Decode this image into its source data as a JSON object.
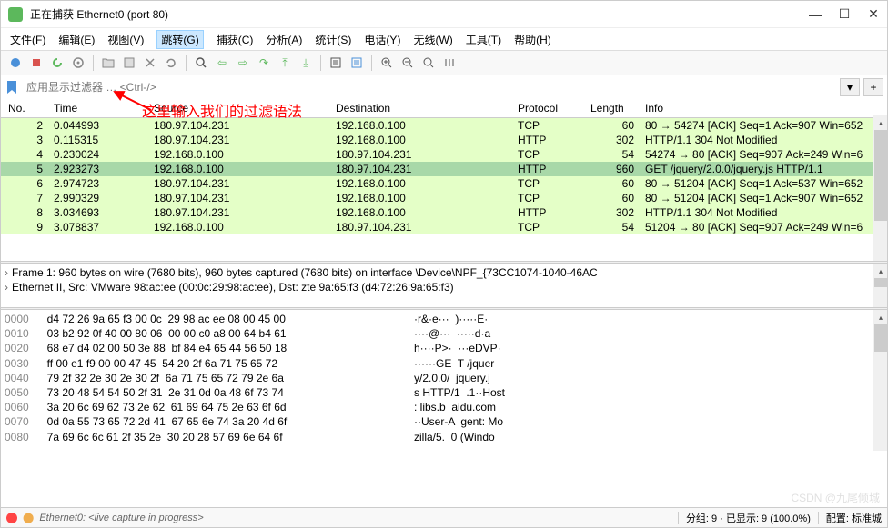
{
  "window": {
    "title": "正在捕获 Ethernet0 (port 80)",
    "min": "—",
    "max": "☐",
    "close": "✕"
  },
  "menu": [
    {
      "label": "文件",
      "key": "F"
    },
    {
      "label": "编辑",
      "key": "E"
    },
    {
      "label": "视图",
      "key": "V"
    },
    {
      "label": "跳转",
      "key": "G",
      "highlight": true
    },
    {
      "label": "捕获",
      "key": "C"
    },
    {
      "label": "分析",
      "key": "A"
    },
    {
      "label": "统计",
      "key": "S"
    },
    {
      "label": "电话",
      "key": "Y"
    },
    {
      "label": "无线",
      "key": "W"
    },
    {
      "label": "工具",
      "key": "T"
    },
    {
      "label": "帮助",
      "key": "H"
    }
  ],
  "filter": {
    "placeholder": "应用显示过滤器 … <Ctrl-/>",
    "plus": "+"
  },
  "annotation": "这里输入我们的过滤语法",
  "columns": {
    "no": "No.",
    "time": "Time",
    "source": "Source",
    "destination": "Destination",
    "protocol": "Protocol",
    "length": "Length",
    "info": "Info"
  },
  "packets": [
    {
      "no": "2",
      "time": "0.044993",
      "src": "180.97.104.231",
      "dst": "192.168.0.100",
      "proto": "TCP",
      "len": "60",
      "info": "80 → 54274 [ACK] Seq=1 Ack=907 Win=652",
      "cls": "row-green"
    },
    {
      "no": "3",
      "time": "0.115315",
      "src": "180.97.104.231",
      "dst": "192.168.0.100",
      "proto": "HTTP",
      "len": "302",
      "info": "HTTP/1.1 304 Not Modified",
      "cls": "row-green"
    },
    {
      "no": "4",
      "time": "0.230024",
      "src": "192.168.0.100",
      "dst": "180.97.104.231",
      "proto": "TCP",
      "len": "54",
      "info": "54274 → 80 [ACK] Seq=907 Ack=249 Win=6",
      "cls": "row-green"
    },
    {
      "no": "5",
      "time": "2.923273",
      "src": "192.168.0.100",
      "dst": "180.97.104.231",
      "proto": "HTTP",
      "len": "960",
      "info": "GET /jquery/2.0.0/jquery.js HTTP/1.1",
      "cls": "row-blue-sel"
    },
    {
      "no": "6",
      "time": "2.974723",
      "src": "180.97.104.231",
      "dst": "192.168.0.100",
      "proto": "TCP",
      "len": "60",
      "info": "80 → 51204 [ACK] Seq=1 Ack=537 Win=652",
      "cls": "row-green"
    },
    {
      "no": "7",
      "time": "2.990329",
      "src": "180.97.104.231",
      "dst": "192.168.0.100",
      "proto": "TCP",
      "len": "60",
      "info": "80 → 51204 [ACK] Seq=1 Ack=907 Win=652",
      "cls": "row-green"
    },
    {
      "no": "8",
      "time": "3.034693",
      "src": "180.97.104.231",
      "dst": "192.168.0.100",
      "proto": "HTTP",
      "len": "302",
      "info": "HTTP/1.1 304 Not Modified",
      "cls": "row-green"
    },
    {
      "no": "9",
      "time": "3.078837",
      "src": "192.168.0.100",
      "dst": "180.97.104.231",
      "proto": "TCP",
      "len": "54",
      "info": "51204 → 80 [ACK] Seq=907 Ack=249 Win=6",
      "cls": "row-green"
    }
  ],
  "details": [
    "Frame 1: 960 bytes on wire (7680 bits), 960 bytes captured (7680 bits) on interface \\Device\\NPF_{73CC1074-1040-46AC",
    "Ethernet II, Src: VMware 98:ac:ee (00:0c:29:98:ac:ee), Dst: zte 9a:65:f3 (d4:72:26:9a:65:f3)"
  ],
  "hex": [
    {
      "off": "0000",
      "b": "d4 72 26 9a 65 f3 00 0c  29 98 ac ee 08 00 45 00",
      "a": "·r&·e···  )·····E·"
    },
    {
      "off": "0010",
      "b": "03 b2 92 0f 40 00 80 06  00 00 c0 a8 00 64 b4 61",
      "a": "····@···  ·····d·a"
    },
    {
      "off": "0020",
      "b": "68 e7 d4 02 00 50 3e 88  bf 84 e4 65 44 56 50 18",
      "a": "h····P>·  ···eDVP·"
    },
    {
      "off": "0030",
      "b": "ff 00 e1 f9 00 00 47 45  54 20 2f 6a 71 75 65 72",
      "a": "······GE  T /jquer"
    },
    {
      "off": "0040",
      "b": "79 2f 32 2e 30 2e 30 2f  6a 71 75 65 72 79 2e 6a",
      "a": "y/2.0.0/  jquery.j"
    },
    {
      "off": "0050",
      "b": "73 20 48 54 54 50 2f 31  2e 31 0d 0a 48 6f 73 74",
      "a": "s HTTP/1  .1··Host"
    },
    {
      "off": "0060",
      "b": "3a 20 6c 69 62 73 2e 62  61 69 64 75 2e 63 6f 6d",
      "a": ": libs.b  aidu.com"
    },
    {
      "off": "0070",
      "b": "0d 0a 55 73 65 72 2d 41  67 65 6e 74 3a 20 4d 6f",
      "a": "··User-A  gent: Mo"
    },
    {
      "off": "0080",
      "b": "7a 69 6c 6c 61 2f 35 2e  30 20 28 57 69 6e 64 6f",
      "a": "zilla/5.  0 (Windo"
    }
  ],
  "status": {
    "left": "Ethernet0: <live capture in progress>",
    "packets": "分组: 9 · 已显示: 9 (100.0%)",
    "profile": "配置: 标准城"
  },
  "watermark": "CSDN @九尾倾城"
}
